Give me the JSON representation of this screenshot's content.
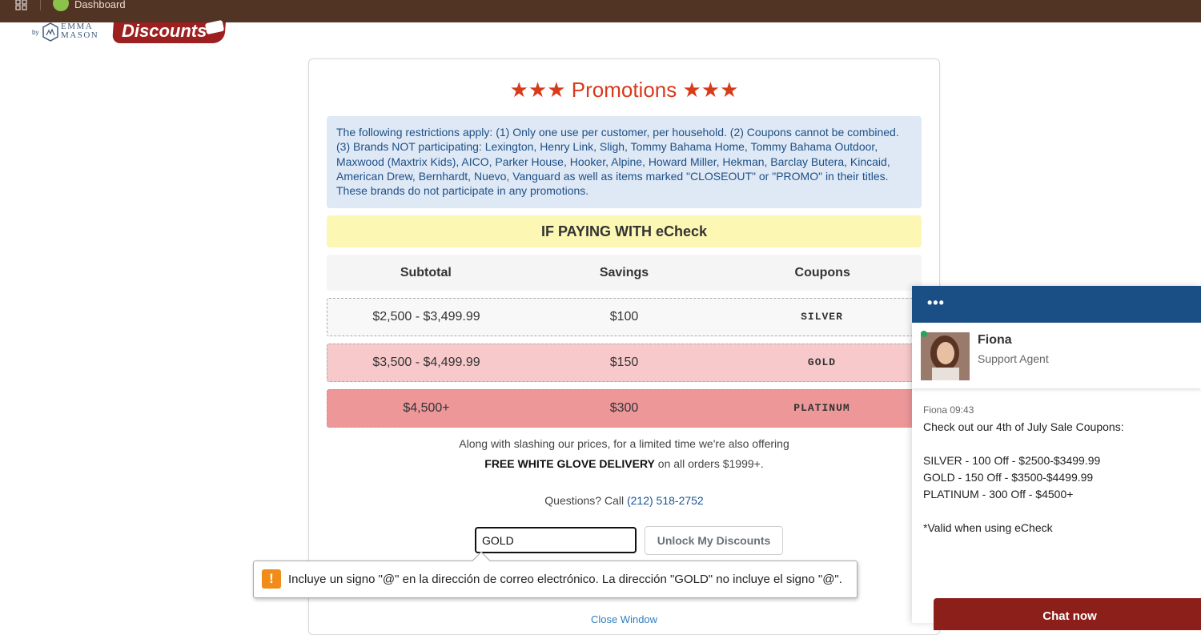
{
  "browser": {
    "bookmark_label": "Dashboard"
  },
  "logo": {
    "by": "by",
    "brand_line1": "EMMA",
    "brand_line2": "MASON",
    "discounts": "Discounts"
  },
  "promotions": {
    "title": "★★★ Promotions ★★★",
    "restrictions": "The following restrictions apply: (1) Only one use per customer, per household. (2) Coupons cannot be combined. (3) Brands NOT participating: Lexington, Henry Link, Sligh, Tommy Bahama Home, Tommy Bahama Outdoor, Maxwood (Maxtrix Kids), AICO, Parker House, Hooker, Alpine, Howard Miller, Hekman, Barclay Butera, Kincaid, American Drew, Bernhardt, Nuevo, Vanguard as well as items marked \"CLOSEOUT\" or \"PROMO\" in their titles. These brands do not participate in any promotions.",
    "echeck_banner": "IF PAYING WITH eCheck",
    "table": {
      "headers": [
        "Subtotal",
        "Savings",
        "Coupons"
      ],
      "rows": [
        {
          "subtotal": "$2,500 - $3,499.99",
          "savings": "$100",
          "coupon": "SILVER"
        },
        {
          "subtotal": "$3,500 - $4,499.99",
          "savings": "$150",
          "coupon": "GOLD"
        },
        {
          "subtotal": "$4,500+",
          "savings": "$300",
          "coupon": "PLATINUM"
        }
      ]
    },
    "offer_line1": "Along with slashing our prices, for a limited time we're also offering",
    "offer_bold": "FREE WHITE GLOVE DELIVERY",
    "offer_rest": " on all orders $1999+.",
    "questions_prefix": "Questions? Call ",
    "phone": "(212) 518-2752",
    "input_value": "GOLD",
    "unlock_button": "Unlock My Discounts",
    "close_window": "Close Window"
  },
  "tooltip": {
    "message": "Incluye un signo \"@\" en la dirección de correo electrónico. La dirección \"GOLD\" no incluye el signo \"@\"."
  },
  "chat": {
    "menu": "•••",
    "agent_name": "Fiona",
    "agent_role": "Support Agent",
    "message_meta": "Fiona 09:43",
    "message_lines": [
      "Check out our 4th of July Sale Coupons:",
      "SILVER - 100 Off - $2500-$3499.99",
      "GOLD - 150 Off - $3500-$4499.99",
      "PLATINUM - 300 Off - $4500+",
      "*Valid when using eCheck"
    ],
    "chat_now": "Chat now"
  },
  "colors": {
    "topbar": "#523424",
    "title_red": "#d83a1a",
    "restrictions_bg": "#dfe9f6",
    "echeck_bg": "#fdf7b4",
    "gold_row": "#f7c9cb",
    "platinum_row": "#ed9799",
    "chat_header": "#1a4f86",
    "chat_now": "#8d1f1a"
  }
}
